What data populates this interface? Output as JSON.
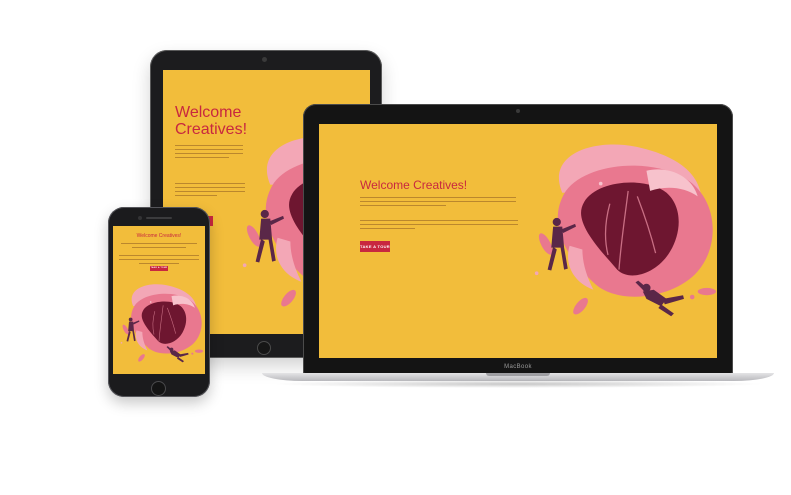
{
  "hero": {
    "title": "Welcome Creatives!",
    "cta_label": "TAKE A TOUR"
  },
  "laptop": {
    "brand": "MacBook"
  },
  "colors": {
    "screen_bg": "#f2bd3b",
    "accent": "#c8283f",
    "blob_pink": "#e9788f",
    "blob_light": "#f3a7b6",
    "blob_dark": "#6e1630",
    "figure": "#5a2748",
    "device_frame": "#1c1c1e",
    "laptop_base": "#d0d0d3"
  },
  "icons": {
    "hero_illustration": "illustration-flowers-and-people"
  }
}
